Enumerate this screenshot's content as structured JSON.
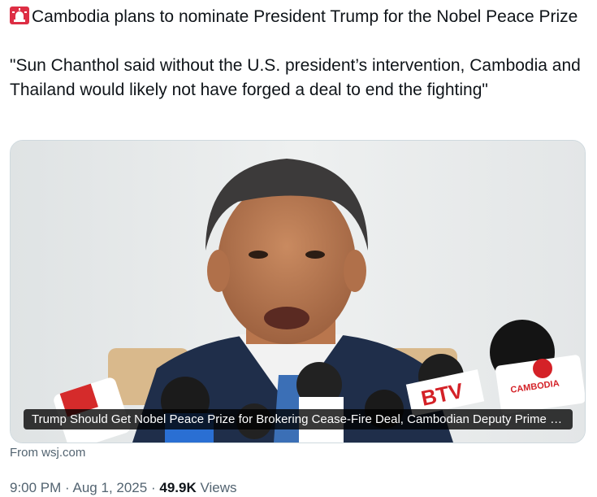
{
  "tweet": {
    "headline_icon": "rotating-light-icon",
    "headline": "Cambodia plans to nominate President Trump for the Nobel Peace Prize",
    "quote": "\"Sun Chanthol said without the U.S. president’s intervention, Cambodia and Thailand would likely not have forged a deal to end the fighting\""
  },
  "card": {
    "caption": "Trump Should Get Nobel Peace Prize for Brokering Cease-Fire Deal, Cambodian Deputy Prime Minister Says",
    "source": "From wsj.com",
    "mic_labels": [
      "BTV",
      "CAMBODIA"
    ]
  },
  "meta": {
    "time": "9:00 PM",
    "separator": "·",
    "date": "Aug 1, 2025",
    "views_count": "49.9K",
    "views_label": "Views"
  },
  "colors": {
    "text_primary": "#0f1419",
    "text_secondary": "#536471",
    "card_border": "#cfd9de"
  }
}
